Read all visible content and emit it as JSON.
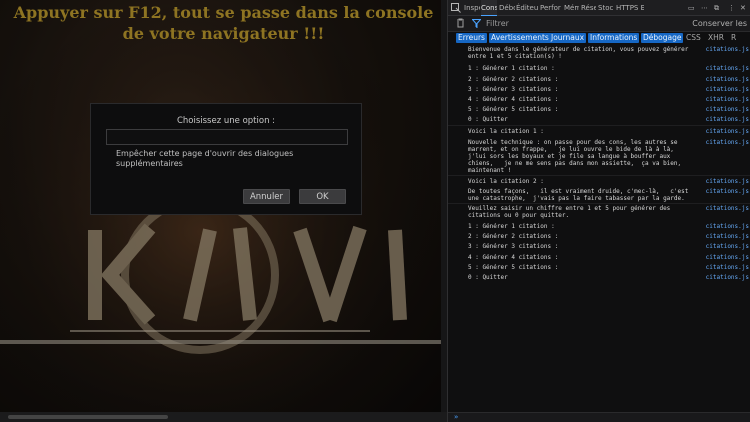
{
  "page": {
    "title_line1": "Appuyer sur F12, tout se passe dans la console",
    "title_line2": "de votre navigateur !!!"
  },
  "dialog": {
    "message": "Choisissez une option :",
    "input_value": "",
    "checkbox_label": "Empêcher cette page d'ouvrir des dialogues supplémentaires",
    "cancel_label": "Annuler",
    "ok_label": "OK"
  },
  "devtools": {
    "tabs": [
      "Inspe",
      "Cons",
      "Débo",
      "Éditeur",
      "Perfor",
      "Mém",
      "Rése",
      "Stoc",
      "HTTPS E"
    ],
    "active_tab": "Cons",
    "filter_placeholder": "Filtrer",
    "persist_label": "Conserver les",
    "levels": [
      "Erreurs",
      "Avertissements",
      "Journaux",
      "Informations",
      "Débogage",
      "CSS",
      "XHR",
      "R"
    ],
    "source_label": "citations.js",
    "messages": [
      "Bienvenue dans le générateur de citation, vous pouvez générer\nentre 1 et 5 citation(s) !",
      "1 : Générer 1 citation :",
      "2 : Générer 2 citations :",
      "3 : Générer 3 citations :",
      "4 : Générer 4 citations :",
      "5 : Générer 5 citations :",
      "0 : Quitter",
      "Voici la citation 1 :",
      "Nouvelle technique : on passe pour des cons, les autres se\nmarrent, et on frappe,   je lui ouvre le bide de là à là,\nj'lui sors les boyaux et je file sa langue à bouffer aux\nchiens,   je ne me sens pas dans mon assiette,  ça va bien,\nmaintenant !",
      "Voici la citation 2 :",
      "De toutes façons,   il est vraiment druide, c'mec-là,   c'est\nune catastrophe,  j'vais pas la faire tabasser par la garde.",
      "Veuillez saisir un chiffre entre 1 et 5 pour générer des\ncitations ou 0 pour quitter.",
      "1 : Générer 1 citation :",
      "2 : Générer 2 citations :",
      "3 : Générer 3 citations :",
      "4 : Générer 4 citations :",
      "5 : Générer 5 citations :",
      "0 : Quitter"
    ]
  },
  "colors": {
    "title": "#8e7422",
    "link": "#65a8f5",
    "filter_active": "#1667c4"
  }
}
